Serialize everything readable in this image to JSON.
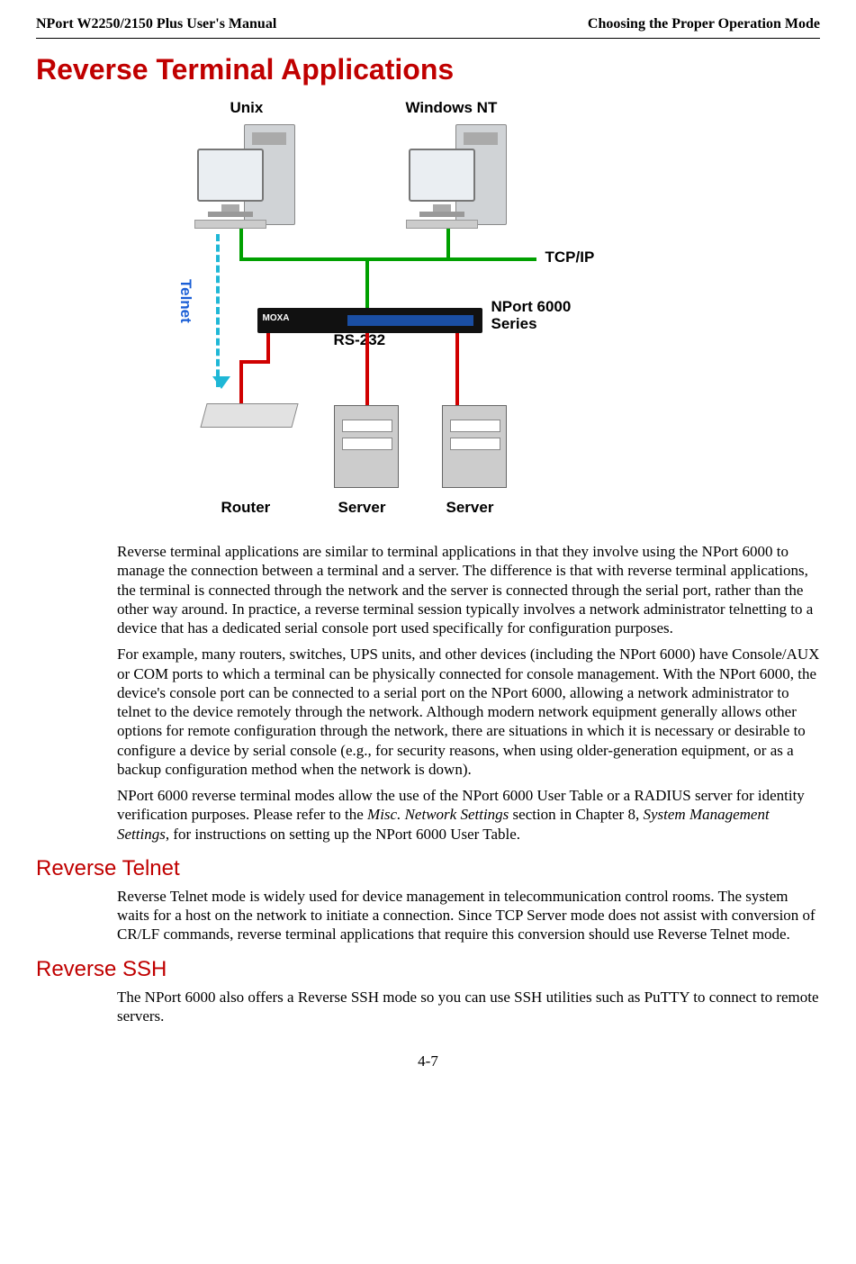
{
  "header": {
    "left": "NPort W2250/2150 Plus User's Manual",
    "right": "Choosing the Proper Operation Mode"
  },
  "title": "Reverse Terminal Applications",
  "diagram": {
    "unix": "Unix",
    "windowsnt": "Windows NT",
    "tcpip": "TCP/IP",
    "rs232": "RS-232",
    "telnet": "Telnet",
    "nport1": "NPort 6000",
    "nport2": "Series",
    "router": "Router",
    "server1": "Server",
    "server2": "Server",
    "moxa": "MOXA"
  },
  "para1": "Reverse terminal applications are similar to terminal applications in that they involve using the NPort 6000 to manage the connection between a terminal and a server. The difference is that with reverse terminal applications, the terminal is connected through the network and the server is connected through the serial port, rather than the other way around. In practice, a reverse terminal session typically involves a network administrator telnetting to a device that has a dedicated serial console port used specifically for configuration purposes.",
  "para2a": "For example, many routers, switches, UPS units, and other devices (including the NPort 6000) have Console/AUX or COM ports to which a terminal can be physically connected for console management. With the NPort 6000, the device's console port can be connected to a serial port on the NPort 6000, allowing a network administrator to telnet to the device remotely through the network. Although modern network equipment generally allows other options for remote configuration through the network, there are situations in which it is necessary or desirable to configure a device by serial console (e.g., for security reasons, when using older-generation equipment, or as a backup configuration method when the network is down).",
  "para3a": "NPort 6000 reverse terminal modes allow the use of the NPort 6000 User Table or a RADIUS server for identity verification purposes. Please refer to the ",
  "para3i1": "Misc. Network Settings",
  "para3b": " section in Chapter 8, ",
  "para3i2": "System Management Settings",
  "para3c": ", for instructions on setting up the NPort 6000 User Table.",
  "h2a": "Reverse Telnet",
  "para4": "Reverse Telnet mode is widely used for device management in telecommunication control rooms. The system waits for a host on the network to initiate a connection. Since TCP Server mode does not assist with conversion of CR/LF commands, reverse terminal applications that require this conversion should use Reverse Telnet mode.",
  "h2b": "Reverse SSH",
  "para5": "The NPort 6000 also offers a Reverse SSH mode so you can use SSH utilities such as PuTTY to connect to remote servers.",
  "pagenum": "4-7"
}
